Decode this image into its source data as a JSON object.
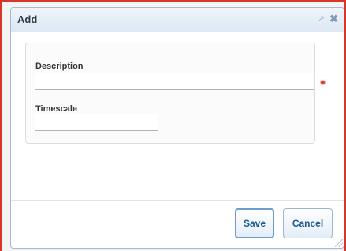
{
  "dialog": {
    "title": "Add",
    "popout_icon": "popout-icon",
    "close_icon": "close-icon"
  },
  "form": {
    "description": {
      "label": "Description",
      "value": "",
      "required": true
    },
    "timescale": {
      "label": "Timescale",
      "value": ""
    }
  },
  "footer": {
    "save_label": "Save",
    "cancel_label": "Cancel"
  },
  "colors": {
    "accent": "#1f5a8c",
    "required": "#e03d3d",
    "frame_border": "#d9362b"
  }
}
